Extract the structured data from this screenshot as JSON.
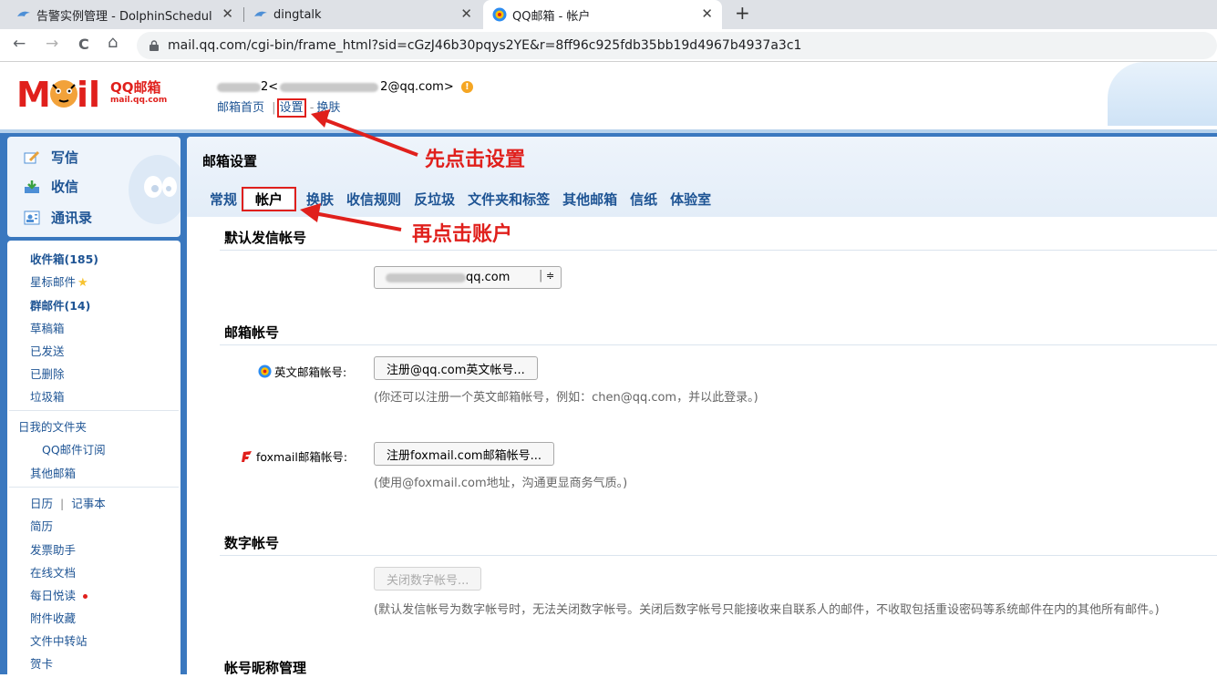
{
  "browser": {
    "tabs": [
      {
        "label": "告警实例管理 - DolphinSchedul",
        "active": false
      },
      {
        "label": "dingtalk",
        "active": false
      },
      {
        "label": "QQ邮箱 - 帐户",
        "active": true
      }
    ],
    "new_tab": "+",
    "close_glyph": "✕",
    "url": "mail.qq.com/cgi-bin/frame_html?sid=cGzJ46b30pqys2YE&r=8ff96c925fdb35bb19d4967b4937a3c1",
    "nav": {
      "back": "←",
      "forward": "→",
      "reload": "C",
      "home": "⌂"
    }
  },
  "header": {
    "logo_text": "QQ邮箱",
    "logo_sub": "mail.qq.com",
    "account_prefix": "2<",
    "account_suffix": "2@qq.com>",
    "warn_glyph": "!",
    "links": {
      "home": "邮箱首页",
      "sep": "|",
      "settings": "设置",
      "dash": "-",
      "skin": "换肤"
    }
  },
  "sidebar": {
    "actions": [
      {
        "label": "写信",
        "icon": "compose-icon"
      },
      {
        "label": "收信",
        "icon": "inbox-download-icon"
      },
      {
        "label": "通讯录",
        "icon": "contacts-icon"
      }
    ],
    "folders": {
      "inbox": "收件箱(185)",
      "starred": "星标邮件",
      "group": "群邮件(14)",
      "drafts": "草稿箱",
      "sent": "已发送",
      "deleted": "已删除",
      "spam": "垃圾箱",
      "my_folders": "日我的文件夹",
      "qq_sub": "QQ邮件订阅",
      "other_mail": "其他邮箱",
      "calendar": "日历",
      "divider": "|",
      "notebook": "记事本",
      "resume": "简历",
      "invoice": "发票助手",
      "docs": "在线文档",
      "daily": "每日悦读",
      "attach": "附件收藏",
      "transfer": "文件中转站",
      "cards": "贺卡"
    }
  },
  "settings": {
    "title": "邮箱设置",
    "tabs": [
      "常规",
      "帐户",
      "换肤",
      "收信规则",
      "反垃圾",
      "文件夹和标签",
      "其他邮箱",
      "信纸",
      "体验室"
    ],
    "active_tab": "帐户",
    "default_sender": {
      "heading": "默认发信帐号",
      "value_suffix": "qq.com",
      "arrow": "≑"
    },
    "mail_accounts": {
      "heading": "邮箱帐号",
      "english_label": "英文邮箱帐号:",
      "english_button": "注册@qq.com英文帐号...",
      "english_hint": "(你还可以注册一个英文邮箱帐号，例如：chen@qq.com，并以此登录。)",
      "foxmail_label": "foxmail邮箱帐号:",
      "foxmail_button": "注册foxmail.com邮箱帐号...",
      "foxmail_hint": "(使用@foxmail.com地址，沟通更显商务气质。)"
    },
    "digital": {
      "heading": "数字帐号",
      "button": "关闭数字帐号...",
      "hint": "(默认发信帐号为数字帐号时，无法关闭数字帐号。关闭后数字帐号只能接收来自联系人的邮件，不收取包括重设密码等系统邮件在内的其他所有邮件。)"
    },
    "nickname": {
      "heading": "帐号昵称管理"
    }
  },
  "annotations": {
    "step1": "先点击设置",
    "step2": "再点击账户",
    "color": "#e0201c"
  },
  "colors": {
    "brand_blue": "#3a78bf",
    "link": "#1e5494",
    "accent_red": "#e0201c"
  }
}
